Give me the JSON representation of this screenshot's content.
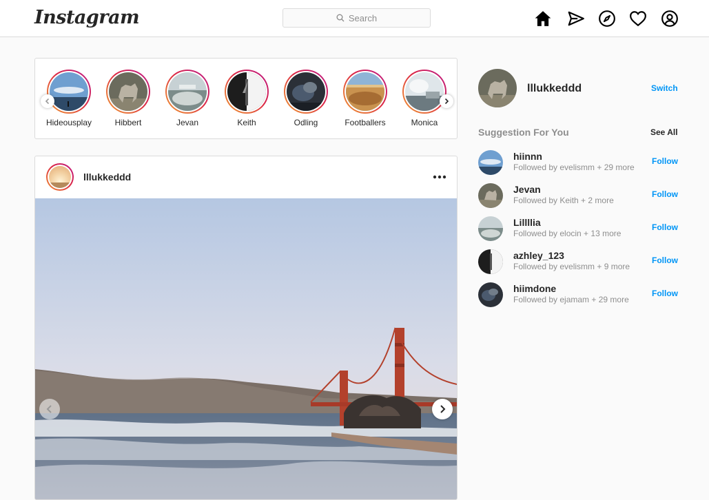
{
  "app": {
    "logo_text": "Instagram",
    "accent_color": "#0095f6"
  },
  "nav": {
    "search_placeholder": "Search",
    "icons": [
      "home-icon",
      "direct-send-icon",
      "explore-compass-icon",
      "activity-heart-icon",
      "profile-icon"
    ]
  },
  "stories": [
    {
      "name": "Hideousplay"
    },
    {
      "name": "Hibbert"
    },
    {
      "name": "Jevan"
    },
    {
      "name": "Keith"
    },
    {
      "name": "Odling"
    },
    {
      "name": "Footballers"
    },
    {
      "name": "Monica"
    }
  ],
  "post": {
    "username": "lllukkeddd"
  },
  "sidebar": {
    "username": "lllukkeddd",
    "switch_label": "Switch",
    "suggestions_title": "Suggestion For You",
    "see_all_label": "See All",
    "suggestions": [
      {
        "name": "hiinnn",
        "subtitle": "Followed by evelismm + 29 more",
        "follow_label": "Follow"
      },
      {
        "name": "Jevan",
        "subtitle": "Followed by Keith + 2 more",
        "follow_label": "Follow"
      },
      {
        "name": "Lillllia",
        "subtitle": "Followed by elocin + 13 more",
        "follow_label": "Follow"
      },
      {
        "name": "azhley_123",
        "subtitle": "Followed by evelismm + 9 more",
        "follow_label": "Follow"
      },
      {
        "name": "hiimdone",
        "subtitle": "Followed by ejamam + 29 more",
        "follow_label": "Follow"
      }
    ]
  }
}
